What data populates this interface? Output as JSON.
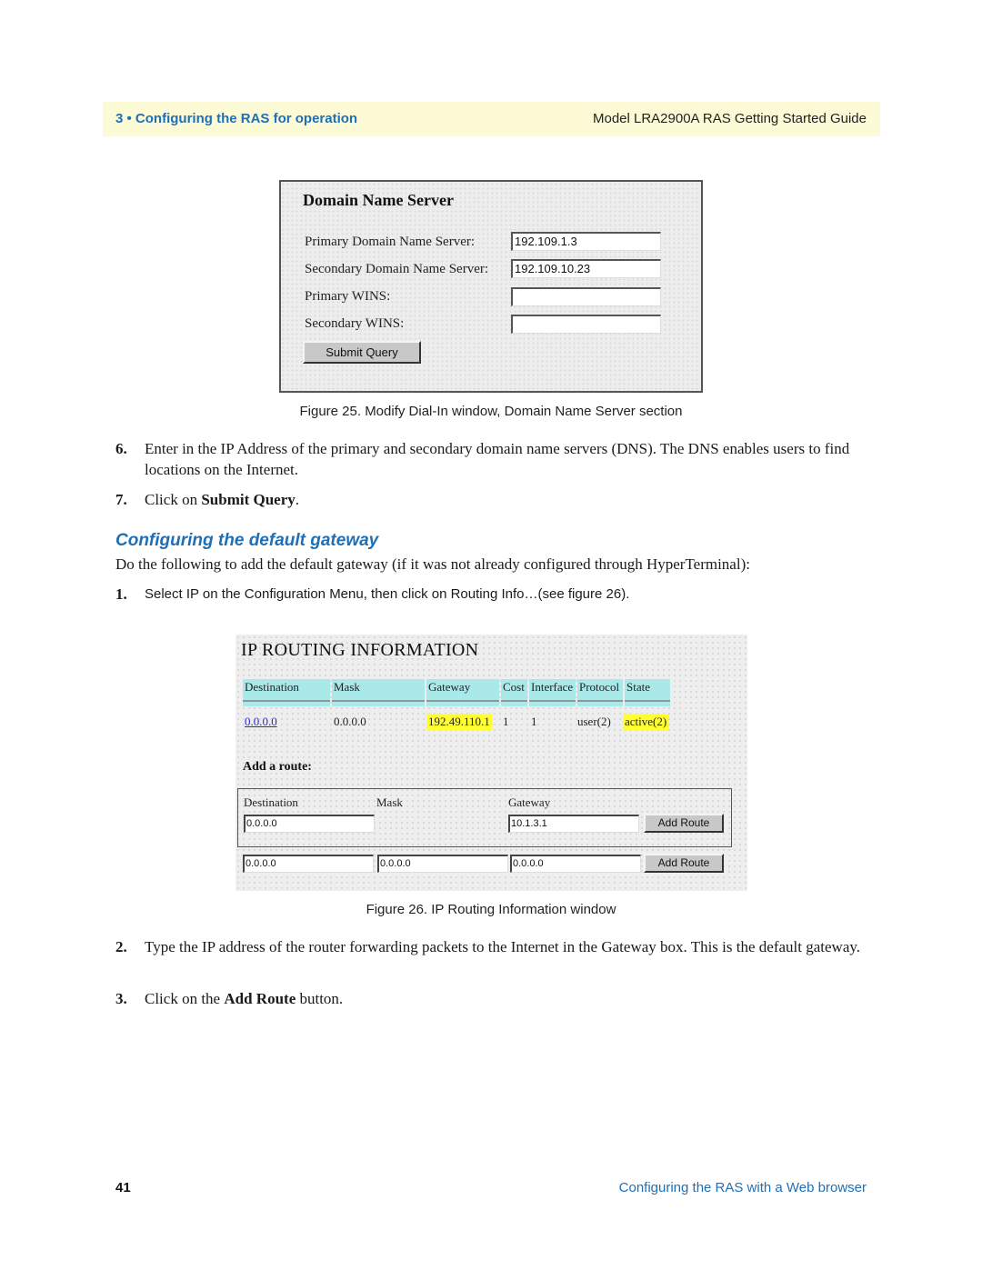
{
  "header": {
    "chapter": "3 • Configuring the RAS for operation",
    "guide_title": "Model LRA2900A RAS Getting Started Guide"
  },
  "figure25": {
    "title": "Domain Name Server",
    "fields": [
      {
        "label": "Primary Domain Name Server:",
        "value": "192.109.1.3"
      },
      {
        "label": "Secondary Domain Name Server:",
        "value": "192.109.10.23"
      },
      {
        "label": "Primary WINS:",
        "value": ""
      },
      {
        "label": "Secondary WINS:",
        "value": ""
      }
    ],
    "submit_label": "Submit Query",
    "caption": "Figure 25. Modify Dial-In window, Domain Name Server section"
  },
  "steps_a": [
    {
      "num": "6.",
      "text": "Enter in the IP Address of the primary and secondary domain name servers (DNS). The DNS enables users to find locations on the Internet."
    },
    {
      "num": "7.",
      "text_pre": "Click on ",
      "text_bold": "Submit Query",
      "text_post": "."
    }
  ],
  "section": {
    "title": "Configuring the default gateway",
    "intro": "Do the following to add the default gateway (if it was not already configured through HyperTerminal):",
    "step1_num": "1.",
    "step1_text": "Select IP on the Configuration Menu, then click on Routing Info…(see figure 26)."
  },
  "figure26": {
    "title": "IP ROUTING INFORMATION",
    "columns": [
      "Destination",
      "Mask",
      "Gateway",
      "Cost",
      "Interface",
      "Protocol",
      "State"
    ],
    "rows": [
      {
        "destination": "0.0.0.0",
        "mask": "0.0.0.0",
        "gateway": "192.49.110.1",
        "cost": "1",
        "interface": "1",
        "protocol": "user(2)",
        "state": "active(2)"
      }
    ],
    "add_route_title": "Add a route:",
    "add_route_labels": {
      "destination": "Destination",
      "mask": "Mask",
      "gateway": "Gateway"
    },
    "add_route_row1": {
      "destination": "0.0.0.0",
      "gateway": "10.1.3.1"
    },
    "add_route_row2": {
      "destination": "0.0.0.0",
      "mask": "0.0.0.0",
      "gateway": "0.0.0.0"
    },
    "add_route_button": "Add Route",
    "caption": "Figure 26. IP Routing Information window"
  },
  "steps_b": [
    {
      "num": "2.",
      "text": "Type the IP address of the router forwarding packets to the Internet in the Gateway box. This is the default gateway."
    },
    {
      "num": "3.",
      "text_pre": "Click on the ",
      "text_bold": "Add Route",
      "text_post": " button."
    }
  ],
  "footer": {
    "page_number": "41",
    "section_title": "Configuring the RAS with a Web browser"
  }
}
